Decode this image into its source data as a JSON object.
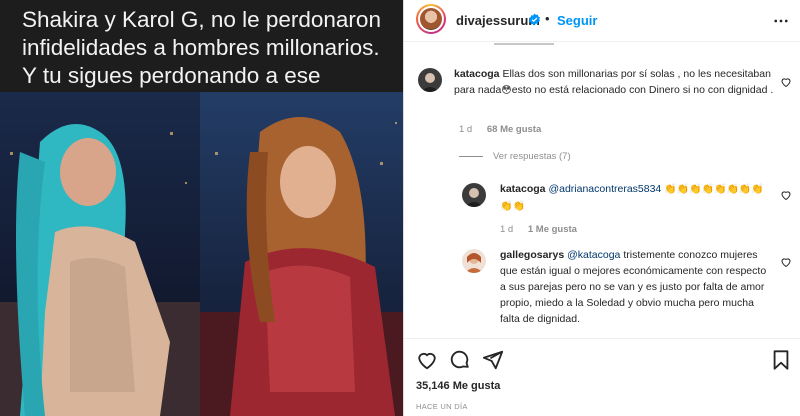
{
  "post_image": {
    "caption": "Shakira y Karol G, no le perdonaron infidelidades a hombres millonarios. Y tu sigues perdonando a ese tacaño."
  },
  "header": {
    "username": "divajessurum",
    "separator": "•",
    "follow_label": "Seguir"
  },
  "comments": [
    {
      "username": "katacoga",
      "text": "Ellas dos son millonarias por sí solas , no les necesitaban para nada",
      "emoji": "😳",
      "text_after": "esto no está relacionado con Dinero si no con dignidad .",
      "age": "1 d",
      "likes": "68 Me gusta",
      "view_replies": "Ver respuestas (7)"
    }
  ],
  "replies": [
    {
      "username": "katacoga",
      "mention": "@adrianacontreras5834",
      "text": "👏👏👏👏👏👏👏👏👏👏",
      "age": "1 d",
      "likes": "1 Me gusta"
    },
    {
      "username": "gallegosarys",
      "mention": "@katacoga",
      "text": "tristemente conozco mujeres que están igual o mejores económicamente con respecto a sus parejas pero no se van y es justo por falta de amor propio, miedo a la Soledad y obvio mucha pero mucha falta de dignidad."
    }
  ],
  "footer": {
    "likes": "35,146 Me gusta",
    "time": "HACE UN DÍA"
  },
  "colors": {
    "link": "#0095f6",
    "mention": "#00376b",
    "muted": "#8e8e8e",
    "verified": "#0095f6"
  },
  "icons": [
    "heart-icon",
    "comment-icon",
    "share-icon",
    "bookmark-icon",
    "more-icon",
    "verified-icon"
  ]
}
